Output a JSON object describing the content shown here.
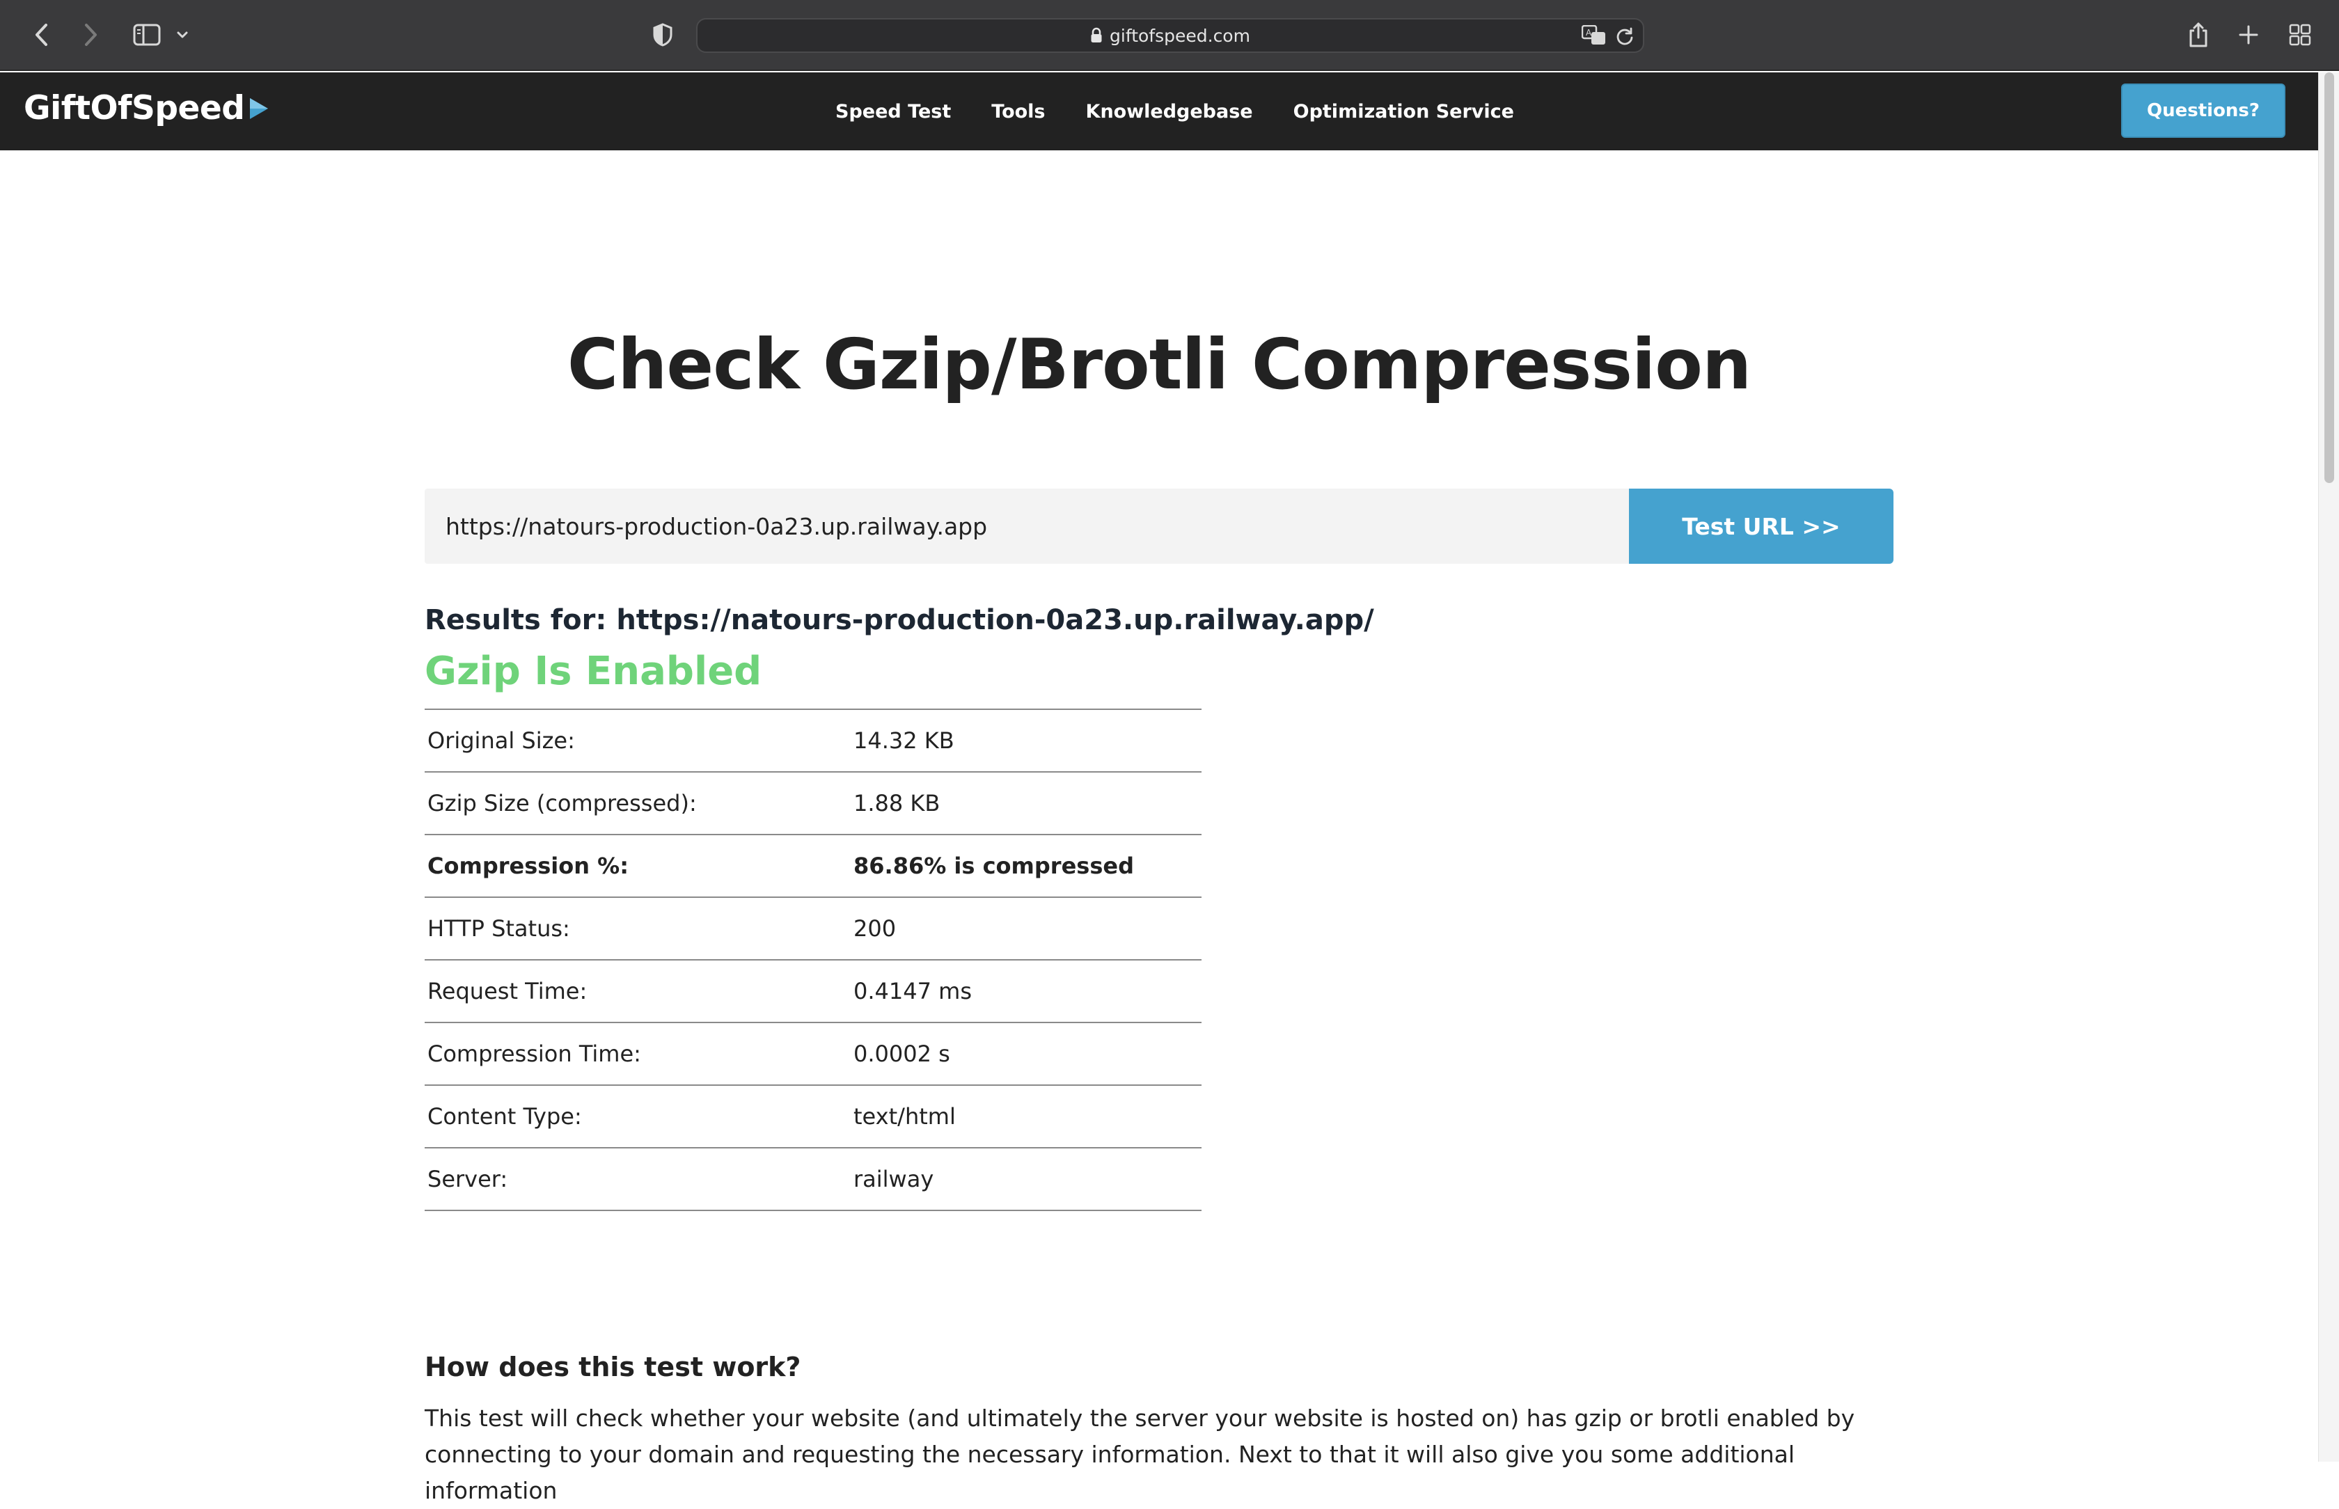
{
  "browser": {
    "address": "giftofspeed.com"
  },
  "header": {
    "logo": "GiftOfSpeed",
    "nav": [
      "Speed Test",
      "Tools",
      "Knowledgebase",
      "Optimization Service"
    ],
    "cta": "Questions?"
  },
  "main": {
    "title": "Check Gzip/Brotli Compression",
    "url_value": "https://natours-production-0a23.up.railway.app",
    "test_button": "Test URL >>",
    "results_heading": "Results for: https://natours-production-0a23.up.railway.app/",
    "status": "Gzip Is Enabled",
    "table": [
      {
        "label": "Original Size:",
        "value": "14.32 KB"
      },
      {
        "label": "Gzip Size (compressed):",
        "value": "1.88 KB"
      },
      {
        "label": "Compression %:",
        "value": "86.86% is compressed"
      },
      {
        "label": "HTTP Status:",
        "value": "200"
      },
      {
        "label": "Request Time:",
        "value": "0.4147 ms"
      },
      {
        "label": "Compression Time:",
        "value": "0.0002 s"
      },
      {
        "label": "Content Type:",
        "value": "text/html"
      },
      {
        "label": "Server:",
        "value": "railway"
      }
    ],
    "how_heading": "How does this test work?",
    "how_body": "This test will check whether your website (and ultimately the server your website is hosted on) has gzip or brotli enabled by connecting to your domain and requesting the necessary information. Next to that it will also give you some additional information"
  },
  "icons": {
    "back": "chevron-left-icon",
    "forward": "chevron-right-icon",
    "sidebar": "sidebar-icon",
    "shield": "privacy-shield-icon",
    "lock": "lock-icon",
    "translate": "translate-icon",
    "reload": "reload-icon",
    "share": "share-icon",
    "new_tab": "plus-icon",
    "tabs": "tab-overview-icon"
  },
  "colors": {
    "accent": "#45a2cf",
    "header_bg": "#222222",
    "success": "#6fd37a",
    "chrome_bg": "#3a3a3c"
  }
}
